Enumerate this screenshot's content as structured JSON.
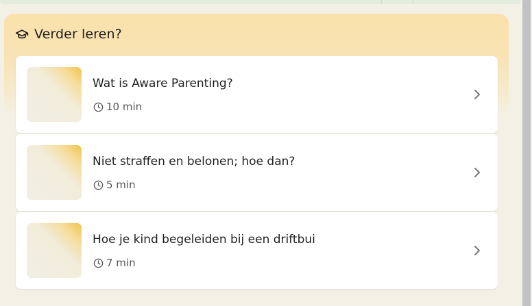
{
  "learn_section": {
    "title": "Verder leren?",
    "header_icon": "graduation-cap-icon",
    "items": [
      {
        "title": "Wat is Aware Parenting?",
        "duration": "10 min"
      },
      {
        "title": "Niet straffen en belonen; hoe dan?",
        "duration": "5 min"
      },
      {
        "title": "Hoe je kind begeleiden bij een driftbui",
        "duration": "7 min"
      }
    ]
  },
  "colors": {
    "panel_gradient_top": "#fae2ab",
    "background": "#f3f0e6",
    "card": "#ffffff",
    "thumb_accent": "#f0c24a"
  }
}
